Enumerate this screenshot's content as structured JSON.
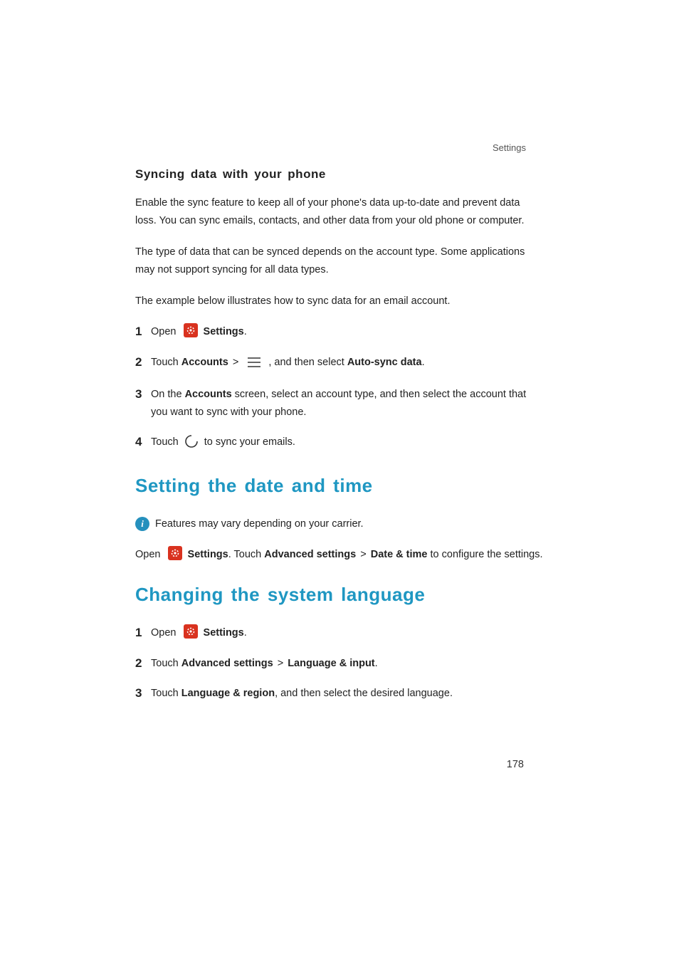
{
  "header": {
    "section_label": "Settings"
  },
  "sync": {
    "heading": "Syncing data with your phone",
    "p1": "Enable the sync feature to keep all of your phone's data up-to-date and prevent data loss. You can sync emails, contacts, and other data from your old phone or computer.",
    "p2": "The type of data that can be synced depends on the account type. Some applications may not support syncing for all data types.",
    "p3": "The example below illustrates how to sync data for an email account.",
    "steps": {
      "n1": "1",
      "s1_open": "Open ",
      "s1_settings": "Settings",
      "s1_end": ".",
      "n2": "2",
      "s2_touch": "Touch ",
      "s2_accounts": "Accounts",
      "s2_gt": ">",
      "s2_mid": " , and then select ",
      "s2_autosync": "Auto-sync data",
      "s2_end": ".",
      "n3": "3",
      "s3_a": "On the ",
      "s3_accounts": "Accounts",
      "s3_b": " screen, select an account type, and then select the account that you want to sync with your phone.",
      "n4": "4",
      "s4_a": "Touch ",
      "s4_b": " to sync your emails."
    }
  },
  "datetime": {
    "heading": "Setting the date and time",
    "note": "Features may vary depending on your carrier.",
    "line": {
      "open": "Open ",
      "settings": "Settings",
      "after_settings": ". Touch ",
      "adv": "Advanced settings",
      "gt": ">",
      "dt": "Date & time",
      "end": " to configure the settings."
    }
  },
  "language": {
    "heading": "Changing the system language",
    "steps": {
      "n1": "1",
      "s1_open": "Open ",
      "s1_settings": "Settings",
      "s1_end": ".",
      "n2": "2",
      "s2_touch": "Touch ",
      "s2_adv": "Advanced settings",
      "s2_gt": ">",
      "s2_li": "Language & input",
      "s2_end": ".",
      "n3": "3",
      "s3_touch": "Touch ",
      "s3_lr": "Language & region",
      "s3_end": ", and then select the desired language."
    }
  },
  "page_number": "178",
  "info_badge_char": "i"
}
